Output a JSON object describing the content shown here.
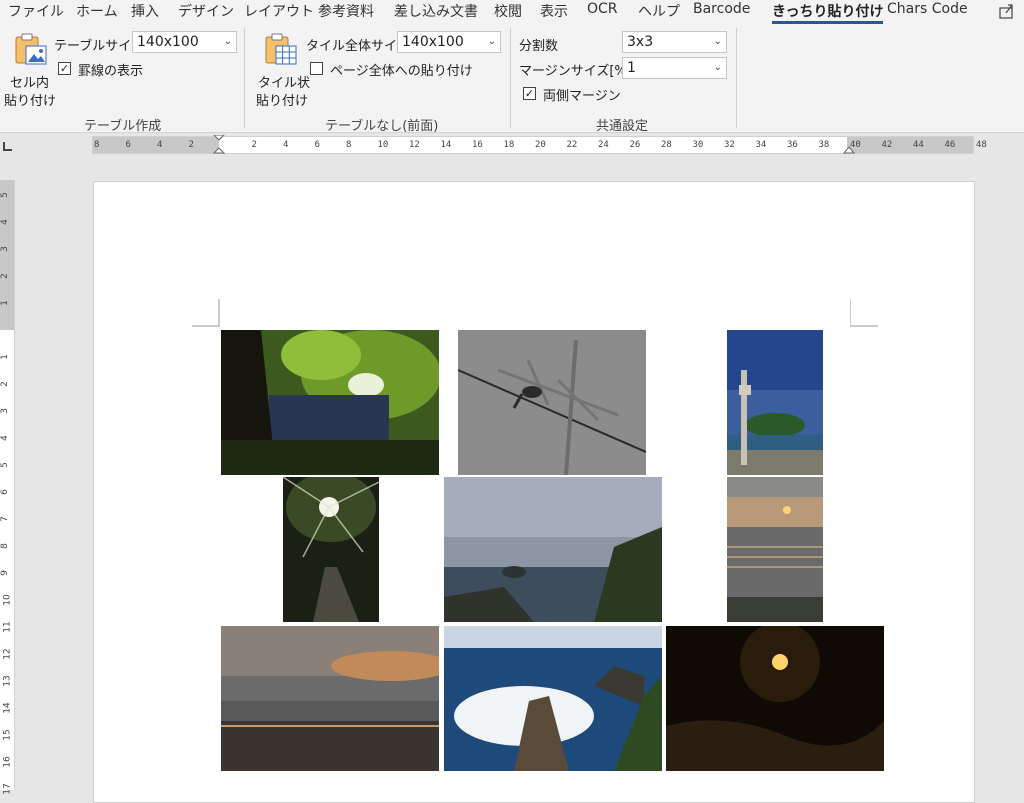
{
  "tabs": [
    {
      "label": "ファイル",
      "active": false
    },
    {
      "label": "ホーム",
      "active": false
    },
    {
      "label": "挿入",
      "active": false
    },
    {
      "label": "デザイン",
      "active": false
    },
    {
      "label": "レイアウト",
      "active": false
    },
    {
      "label": "参考資料",
      "active": false
    },
    {
      "label": "差し込み文書",
      "active": false
    },
    {
      "label": "校閲",
      "active": false
    },
    {
      "label": "表示",
      "active": false
    },
    {
      "label": "OCR",
      "active": false
    },
    {
      "label": "ヘルプ",
      "active": false
    },
    {
      "label": "Barcode",
      "active": false
    },
    {
      "label": "きっちり貼り付け",
      "active": true
    },
    {
      "label": "Chars Code",
      "active": false
    }
  ],
  "ribbon": {
    "table_create": {
      "big_button_line1": "セル内",
      "big_button_line2": "貼り付け",
      "size_label": "テーブルサイズ",
      "size_value": "140x100",
      "border_label": "罫線の表示",
      "border_checked": true,
      "group_label": "テーブル作成"
    },
    "no_table": {
      "big_button_line1": "タイル状",
      "big_button_line2": "貼り付け",
      "size_label": "タイル全体サイズ",
      "size_value": "140x100",
      "page_label": "ページ全体への貼り付け",
      "page_checked": false,
      "group_label": "テーブルなし(前面)"
    },
    "common": {
      "split_label": "分割数",
      "split_value": "3x3",
      "margin_label": "マージンサイズ[%]",
      "margin_value": "1",
      "both_label": "両側マージン",
      "both_checked": true,
      "group_label": "共通設定"
    }
  },
  "ruler": {
    "h_ticks": [
      "8",
      "6",
      "4",
      "2",
      "",
      "2",
      "4",
      "6",
      "8",
      "10",
      "12",
      "14",
      "16",
      "18",
      "20",
      "22",
      "24",
      "26",
      "28",
      "30",
      "32",
      "34",
      "36",
      "38",
      "40",
      "42",
      "44",
      "46",
      "48"
    ],
    "v_ticks": [
      "5",
      "4",
      "3",
      "2",
      "1",
      "",
      "1",
      "2",
      "3",
      "4",
      "5",
      "6",
      "7",
      "8",
      "9",
      "10",
      "11",
      "12",
      "13",
      "14",
      "15",
      "16",
      "17"
    ]
  },
  "colors": {
    "accent": "#2b579a",
    "ribbon_bg": "#f3f3f3",
    "canvas_bg": "#e6e6e6"
  },
  "images": [
    {
      "name": "forest-canopy-photo"
    },
    {
      "name": "bird-on-wire-photo"
    },
    {
      "name": "coastal-pole-photo"
    },
    {
      "name": "forest-path-sunburst-photo"
    },
    {
      "name": "coast-rocks-cloudy-photo"
    },
    {
      "name": "sunset-over-sea-photo"
    },
    {
      "name": "beach-dusk-photo"
    },
    {
      "name": "waves-rocks-photo"
    },
    {
      "name": "moon-night-photo"
    }
  ]
}
